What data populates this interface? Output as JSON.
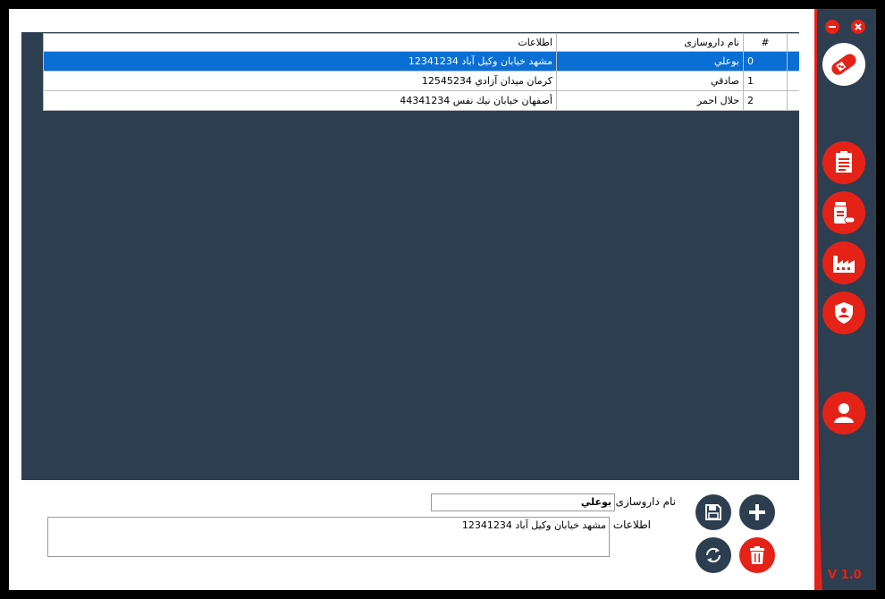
{
  "grid": {
    "headers": {
      "num": "#",
      "name": "نام داروسازی",
      "info": "اطلاعات"
    },
    "rows": [
      {
        "num": "0",
        "name": "بوعلي",
        "info": "مشهد خيابان وكيل آباد 12341234"
      },
      {
        "num": "1",
        "name": "صادقي",
        "info": "كرمان ميدان آزادي 12545234"
      },
      {
        "num": "2",
        "name": "حلال احمر",
        "info": "أصفهان خيابان نيك نفس 44341234"
      }
    ]
  },
  "form": {
    "name_label": "نام داروسازی",
    "name_value": "بوعلي",
    "info_label": "اطلاعات",
    "info_value": "مشهد خيابان وكيل آباد 12341234"
  },
  "actions": {
    "save": "save-icon",
    "add": "plus-icon",
    "refresh": "refresh-icon",
    "delete": "trash-icon"
  },
  "sidebar": {
    "items": [
      "document-icon",
      "medicine-icon",
      "factory-icon",
      "shield-user-icon",
      "user-icon"
    ],
    "version": "V 1.0"
  },
  "colors": {
    "accent": "#e52217",
    "panel": "#2d3e50",
    "selection": "#0a6fd4"
  }
}
